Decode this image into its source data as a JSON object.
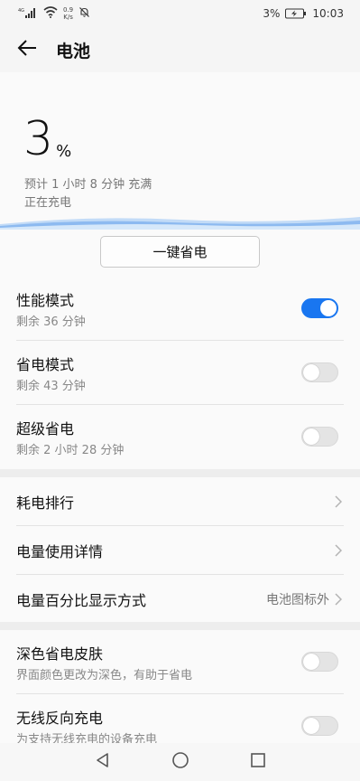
{
  "status_bar": {
    "signal": "4G",
    "net_speed_value": "0.9",
    "net_speed_unit": "K/s",
    "battery_percent": "3%",
    "time": "10:03"
  },
  "header": {
    "title": "电池"
  },
  "battery": {
    "level_number": "3",
    "level_unit": "%",
    "level_fraction": 0.03,
    "estimate": "预计 1 小时 8 分钟 充满",
    "charging_status": "正在充电"
  },
  "power_saver_button": "一键省电",
  "modes": [
    {
      "title": "性能模式",
      "subtitle": "剩余 36 分钟",
      "enabled": true
    },
    {
      "title": "省电模式",
      "subtitle": "剩余 43 分钟",
      "enabled": false
    },
    {
      "title": "超级省电",
      "subtitle": "剩余 2 小时 28 分钟",
      "enabled": false
    }
  ],
  "menu": [
    {
      "title": "耗电排行",
      "value": ""
    },
    {
      "title": "电量使用详情",
      "value": ""
    },
    {
      "title": "电量百分比显示方式",
      "value": "电池图标外"
    }
  ],
  "extras": [
    {
      "title": "深色省电皮肤",
      "subtitle": "界面颜色更改为深色，有助于省电",
      "enabled": false
    },
    {
      "title": "无线反向充电",
      "subtitle": "为支持无线充电的设备充电",
      "enabled": false
    }
  ],
  "colors": {
    "accent": "#1976f0",
    "wave": "#7fb2ee"
  },
  "icons": {
    "back": "arrow-left-icon",
    "chevron": "chevron-right-icon",
    "nav_back": "triangle-back-icon",
    "nav_home": "circle-home-icon",
    "nav_recents": "square-recents-icon"
  }
}
